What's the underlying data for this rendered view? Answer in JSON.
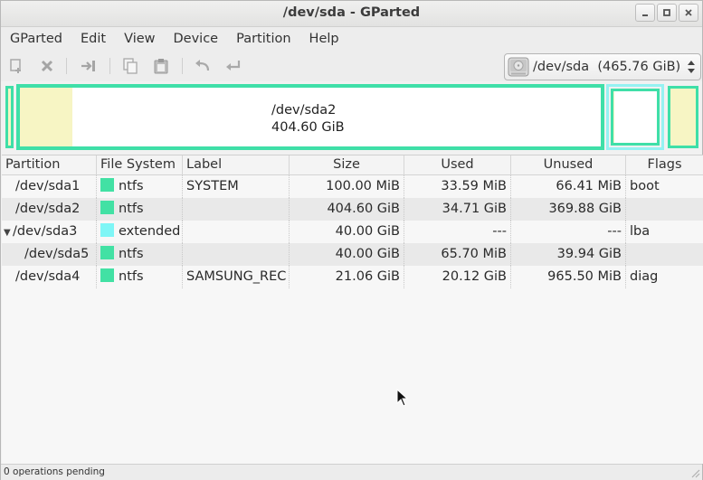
{
  "window": {
    "title": "/dev/sda - GParted"
  },
  "menu": [
    "GParted",
    "Edit",
    "View",
    "Device",
    "Partition",
    "Help"
  ],
  "toolbar": {
    "buttons": [
      {
        "icon": "new-partition-icon"
      },
      {
        "icon": "delete-icon"
      },
      {
        "icon": "resize-move-icon"
      },
      {
        "icon": "copy-icon"
      },
      {
        "icon": "paste-icon"
      },
      {
        "icon": "undo-icon"
      },
      {
        "icon": "apply-icon"
      }
    ],
    "device_selector": "/dev/sda  (465.76 GiB)"
  },
  "diskmap": {
    "selected_label": "/dev/sda2",
    "selected_size": "404.60 GiB"
  },
  "table": {
    "columns": [
      "Partition",
      "File System",
      "Label",
      "Size",
      "Used",
      "Unused",
      "Flags"
    ],
    "rows": [
      {
        "partition": "/dev/sda1",
        "fs": "ntfs",
        "label": "SYSTEM",
        "size": "100.00 MiB",
        "used": "33.59 MiB",
        "unused": "66.41 MiB",
        "flags": "boot"
      },
      {
        "partition": "/dev/sda2",
        "fs": "ntfs",
        "label": "",
        "size": "404.60 GiB",
        "used": "34.71 GiB",
        "unused": "369.88 GiB",
        "flags": ""
      },
      {
        "partition": "/dev/sda3",
        "fs": "extended",
        "label": "",
        "size": "40.00 GiB",
        "used": "---",
        "unused": "---",
        "flags": "lba"
      },
      {
        "partition": "/dev/sda5",
        "fs": "ntfs",
        "label": "",
        "size": "40.00 GiB",
        "used": "65.70 MiB",
        "unused": "39.94 GiB",
        "flags": ""
      },
      {
        "partition": "/dev/sda4",
        "fs": "ntfs",
        "label": "SAMSUNG_REC",
        "size": "21.06 GiB",
        "used": "20.12 GiB",
        "unused": "965.50 MiB",
        "flags": "diag"
      }
    ]
  },
  "colors": {
    "ntfs": "#42e1a4",
    "extended": "#7ef6f6",
    "used_space": "#f7f5c4",
    "partition_border": "#3fdfa8"
  },
  "status": {
    "text": "0 operations pending"
  }
}
